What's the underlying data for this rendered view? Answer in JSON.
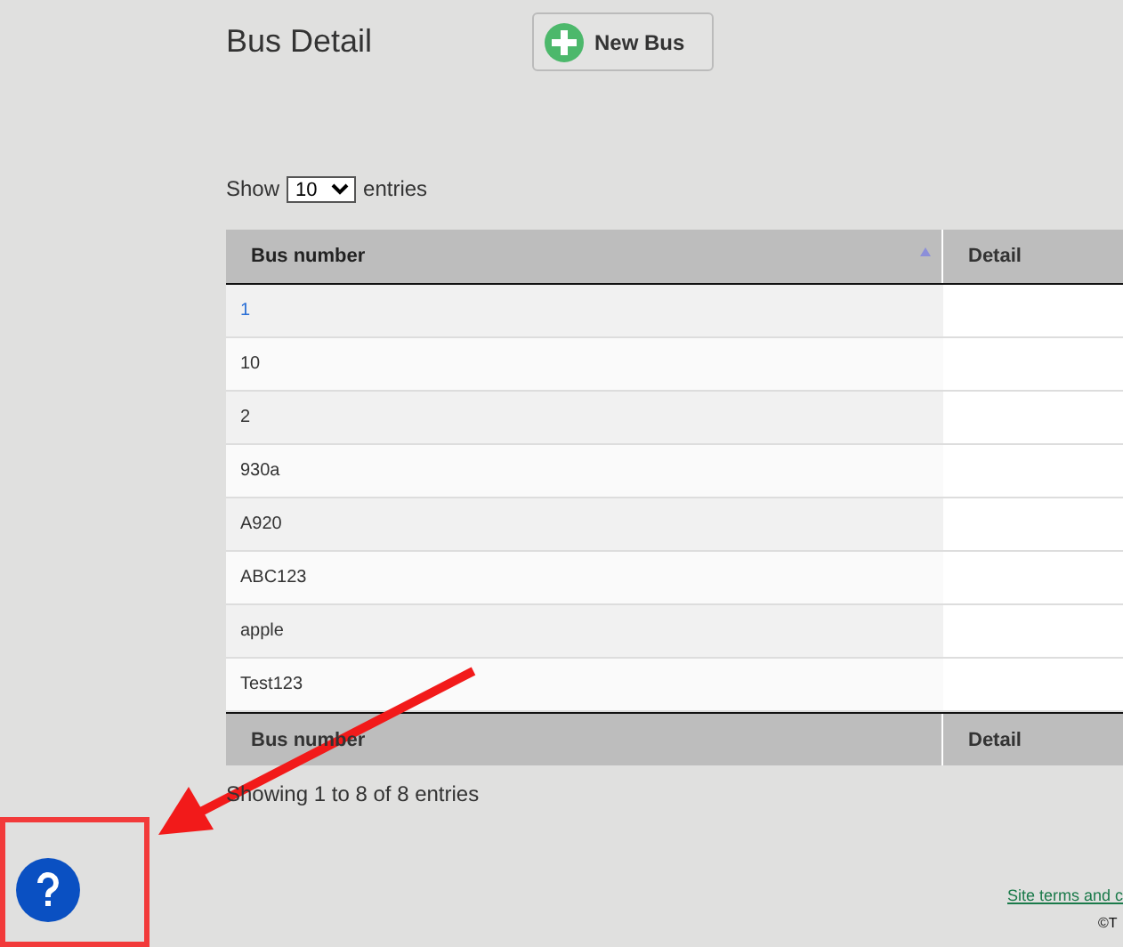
{
  "page": {
    "title": "Bus Detail",
    "new_button": "New Bus"
  },
  "length_menu": {
    "before": "Show",
    "value": "10",
    "after": "entries"
  },
  "table": {
    "columns": [
      {
        "label": "Bus number",
        "sorted": true
      },
      {
        "label": "Detail",
        "sorted": false
      }
    ],
    "rows": [
      {
        "bus_number": "1",
        "active": true
      },
      {
        "bus_number": "10",
        "active": false
      },
      {
        "bus_number": "2",
        "active": false
      },
      {
        "bus_number": "930a",
        "active": false
      },
      {
        "bus_number": "A920",
        "active": false
      },
      {
        "bus_number": "ABC123",
        "active": false
      },
      {
        "bus_number": "apple",
        "active": false
      },
      {
        "bus_number": "Test123",
        "active": false
      }
    ],
    "footer_columns": [
      "Bus number",
      "Detail"
    ]
  },
  "info": "Showing 1 to 8 of 8 entries",
  "footer": {
    "link": "Site terms and c",
    "copyright": "©T"
  },
  "annotation": {
    "kind": "arrow-to-box"
  }
}
